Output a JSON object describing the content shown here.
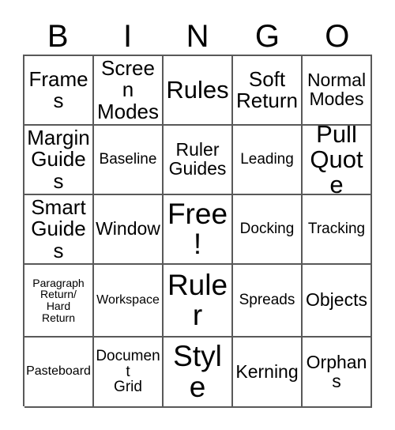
{
  "card": {
    "title": "BINGO",
    "header_letters": [
      "B",
      "I",
      "N",
      "G",
      "O"
    ],
    "grid_line_color": "#595959",
    "background_color": "#ffffff",
    "text_color": "#000000",
    "columns": 5,
    "rows": 5,
    "cells": [
      {
        "text": "Frames",
        "size": "lg"
      },
      {
        "text": "Screen\nModes",
        "size": "lg"
      },
      {
        "text": "Rules",
        "size": "xl"
      },
      {
        "text": "Soft\nReturn",
        "size": "lg"
      },
      {
        "text": "Normal\nModes",
        "size": "md"
      },
      {
        "text": "Margin\nGuides",
        "size": "lg"
      },
      {
        "text": "Baseline",
        "size": "sm"
      },
      {
        "text": "Ruler\nGuides",
        "size": "md"
      },
      {
        "text": "Leading",
        "size": "sm"
      },
      {
        "text": "Pull\nQuote",
        "size": "xl"
      },
      {
        "text": "Smart\nGuides",
        "size": "lg"
      },
      {
        "text": "Window",
        "size": "md"
      },
      {
        "text": "Free!",
        "size": "xxl"
      },
      {
        "text": "Docking",
        "size": "sm"
      },
      {
        "text": "Tracking",
        "size": "sm"
      },
      {
        "text": "Paragraph\nReturn/\nHard\nReturn",
        "size": "xxs"
      },
      {
        "text": "Workspace",
        "size": "xs"
      },
      {
        "text": "Ruler",
        "size": "xxl"
      },
      {
        "text": "Spreads",
        "size": "sm"
      },
      {
        "text": "Objects",
        "size": "md"
      },
      {
        "text": "Pasteboard",
        "size": "xs"
      },
      {
        "text": "Document\nGrid",
        "size": "sm"
      },
      {
        "text": "Style",
        "size": "xxl"
      },
      {
        "text": "Kerning",
        "size": "md"
      },
      {
        "text": "Orphans",
        "size": "md"
      }
    ]
  }
}
